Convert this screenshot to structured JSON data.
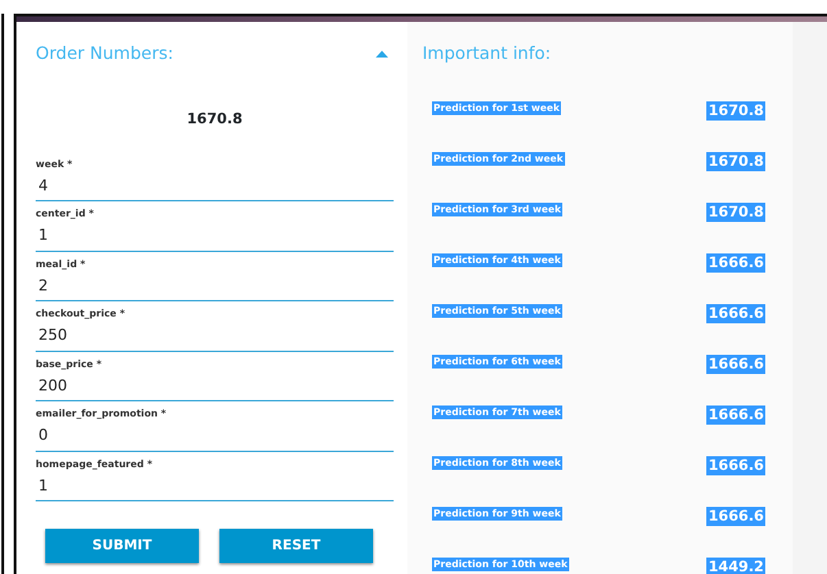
{
  "order_panel": {
    "title": "Order Numbers:",
    "expanded": true,
    "result": "1670.8",
    "fields": [
      {
        "label": "week *",
        "value": "4"
      },
      {
        "label": "center_id *",
        "value": "1"
      },
      {
        "label": "meal_id *",
        "value": "2"
      },
      {
        "label": "checkout_price *",
        "value": "250"
      },
      {
        "label": "base_price *",
        "value": "200"
      },
      {
        "label": "emailer_for_promotion *",
        "value": "0"
      },
      {
        "label": "homepage_featured *",
        "value": "1"
      }
    ],
    "buttons": [
      "SUBMIT",
      "RESET"
    ]
  },
  "info_panel": {
    "title": "Important info:",
    "predictions": [
      {
        "label": "Prediction for 1st week",
        "value": "1670.8",
        "highlighted": true
      },
      {
        "label": "Prediction for 2nd week",
        "value": "1670.8",
        "highlighted": true
      },
      {
        "label": "Prediction for 3rd week",
        "value": "1670.8",
        "highlighted": true
      },
      {
        "label": "Prediction for 4th week",
        "value": "1666.6",
        "highlighted": true
      },
      {
        "label": "Prediction for 5th week",
        "value": "1666.6",
        "highlighted": true
      },
      {
        "label": "Prediction for 6th week",
        "value": "1666.6",
        "highlighted": true
      },
      {
        "label": "Prediction for 7th week",
        "value": "1666.6",
        "highlighted": true
      },
      {
        "label": "Prediction for 8th week",
        "value": "1666.6",
        "highlighted": true
      },
      {
        "label": "Prediction for 9th week",
        "value": "1666.6",
        "highlighted": true
      },
      {
        "label": "Prediction for 10th week",
        "value": "1449.2",
        "highlighted": true
      }
    ]
  }
}
